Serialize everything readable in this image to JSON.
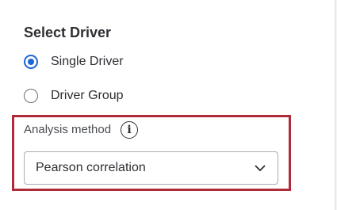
{
  "driver_section": {
    "title": "Select Driver",
    "options": [
      {
        "label": "Single Driver",
        "selected": true
      },
      {
        "label": "Driver Group",
        "selected": false
      }
    ]
  },
  "analysis": {
    "label": "Analysis method",
    "info_icon": "info-icon",
    "selected_value": "Pearson correlation",
    "dropdown_icon": "chevron-down-icon"
  },
  "colors": {
    "accent": "#1b67d6",
    "highlight_border": "#b12a3a",
    "text": "#2d2f33"
  }
}
